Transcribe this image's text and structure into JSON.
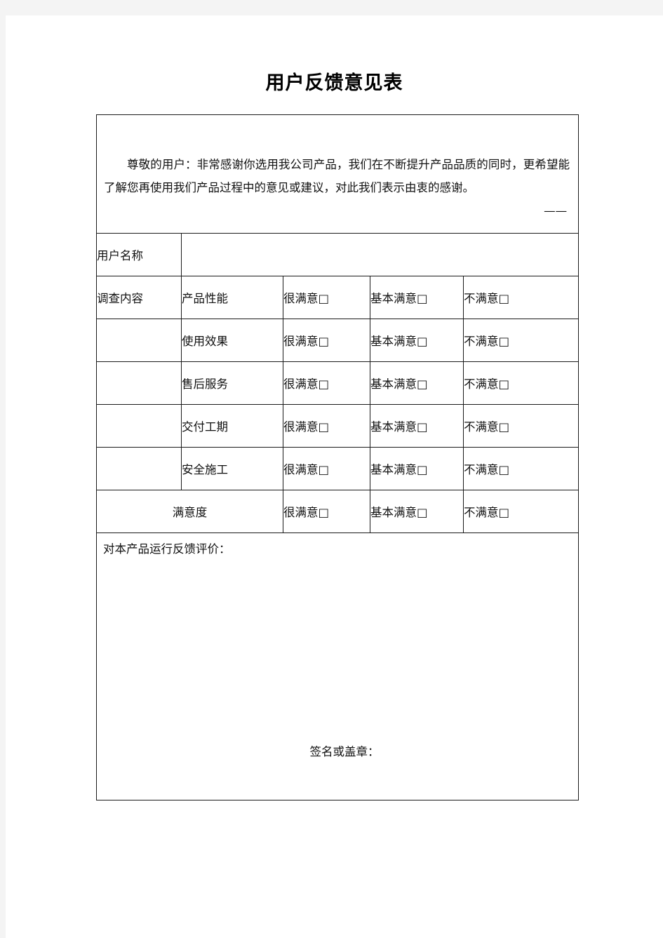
{
  "document": {
    "title": "用户反馈意见表",
    "intro": {
      "paragraph": "尊敬的用户：非常感谢你选用我公司产品，我们在不断提升产品品质的同时，更希望能了解您再使用我们产品过程中的意见或建议，对此我们表示由衷的感谢。",
      "dash": "——"
    },
    "fields": {
      "user_name_label": "用户名称",
      "user_name_value": "",
      "survey_label": "调查内容",
      "total_label": "满意度"
    },
    "options": {
      "very_satisfied": "很满意□",
      "basically_satisfied": "基本满意□",
      "not_satisfied": "不满意□"
    },
    "survey_rows": [
      {
        "item": "产品性能"
      },
      {
        "item": "使用效果"
      },
      {
        "item": "售后服务"
      },
      {
        "item": "交付工期"
      },
      {
        "item": "安全施工"
      }
    ],
    "feedback": {
      "title": "对本产品运行反馈评价：",
      "content": "",
      "signature_label": "签名或盖章："
    },
    "colors": {
      "border": "#1a1a1a",
      "page": "#ffffff",
      "margin": "#f4f4f4",
      "text": "#111111"
    }
  }
}
